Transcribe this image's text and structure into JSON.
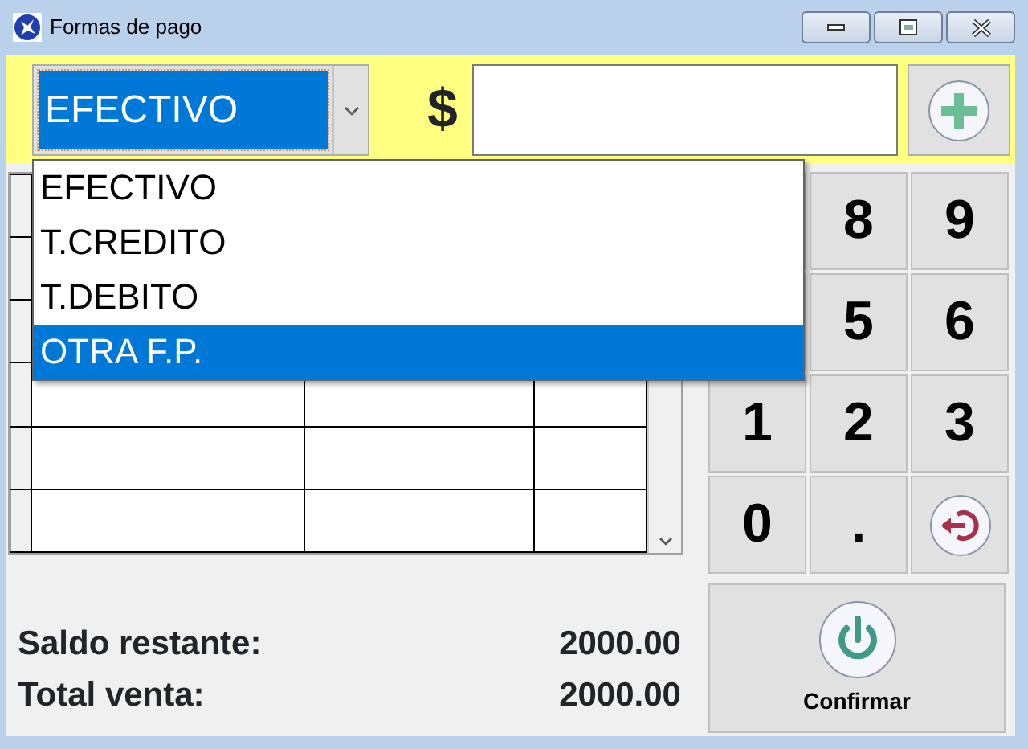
{
  "window": {
    "title": "Formas de pago"
  },
  "payment_method": {
    "value": "EFECTIVO",
    "expanded": true,
    "options": [
      {
        "label": "EFECTIVO",
        "highlighted": false
      },
      {
        "label": "T.CREDITO",
        "highlighted": false
      },
      {
        "label": "T.DEBITO",
        "highlighted": false
      },
      {
        "label": "OTRA F.P.",
        "highlighted": true
      }
    ]
  },
  "amount": {
    "currency_symbol": "$"
  },
  "keypad": [
    {
      "kind": "hidden"
    },
    {
      "kind": "digit",
      "label": "8"
    },
    {
      "kind": "digit",
      "label": "9"
    },
    {
      "kind": "hidden"
    },
    {
      "kind": "digit",
      "label": "5"
    },
    {
      "kind": "digit",
      "label": "6"
    },
    {
      "kind": "digit",
      "label": "1"
    },
    {
      "kind": "digit",
      "label": "2"
    },
    {
      "kind": "digit",
      "label": "3"
    },
    {
      "kind": "digit",
      "label": "0"
    },
    {
      "kind": "digit",
      "label": "."
    },
    {
      "kind": "backspace"
    }
  ],
  "totals": [
    {
      "label": "Saldo restante:",
      "value": "2000.00"
    },
    {
      "label": "Total venta:",
      "value": "2000.00"
    }
  ],
  "confirm_button": {
    "label": "Confirmar"
  }
}
